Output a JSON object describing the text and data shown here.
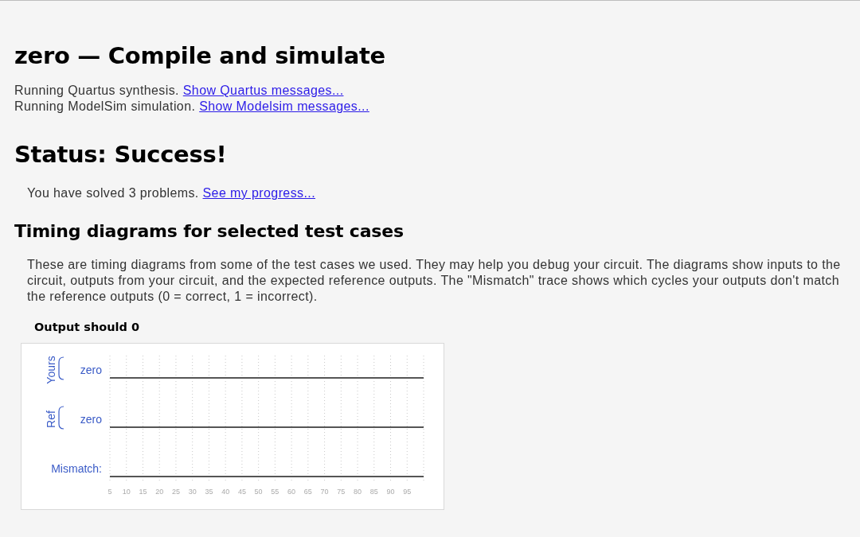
{
  "page": {
    "title": "zero — Compile and simulate"
  },
  "messages": [
    {
      "text": "Running Quartus synthesis.",
      "link": "Show Quartus messages..."
    },
    {
      "text": "Running ModelSim simulation.",
      "link": "Show Modelsim messages..."
    }
  ],
  "status": {
    "heading": "Status: Success!",
    "text": "You have solved 3 problems.",
    "link": "See my progress..."
  },
  "timing": {
    "heading": "Timing diagrams for selected test cases",
    "description": "These are timing diagrams from some of the test cases we used. They may help you debug your circuit. The diagrams show inputs to the circuit, outputs from your circuit, and the expected reference outputs. The \"Mismatch\" trace shows which cycles your outputs don't match the reference outputs (0 = correct, 1 = incorrect).",
    "diagrams": [
      {
        "title": "Output should 0",
        "groups": [
          {
            "label": "Yours",
            "signals": [
              {
                "name": "zero",
                "high": false
              }
            ]
          },
          {
            "label": "Ref",
            "signals": [
              {
                "name": "zero",
                "high": false
              }
            ]
          }
        ],
        "mismatch": {
          "label": "Mismatch:",
          "high": false
        },
        "ticks": [
          "5",
          "10",
          "15",
          "20",
          "25",
          "30",
          "35",
          "40",
          "45",
          "50",
          "55",
          "60",
          "65",
          "70",
          "75",
          "80",
          "85",
          "90",
          "95"
        ]
      }
    ]
  }
}
